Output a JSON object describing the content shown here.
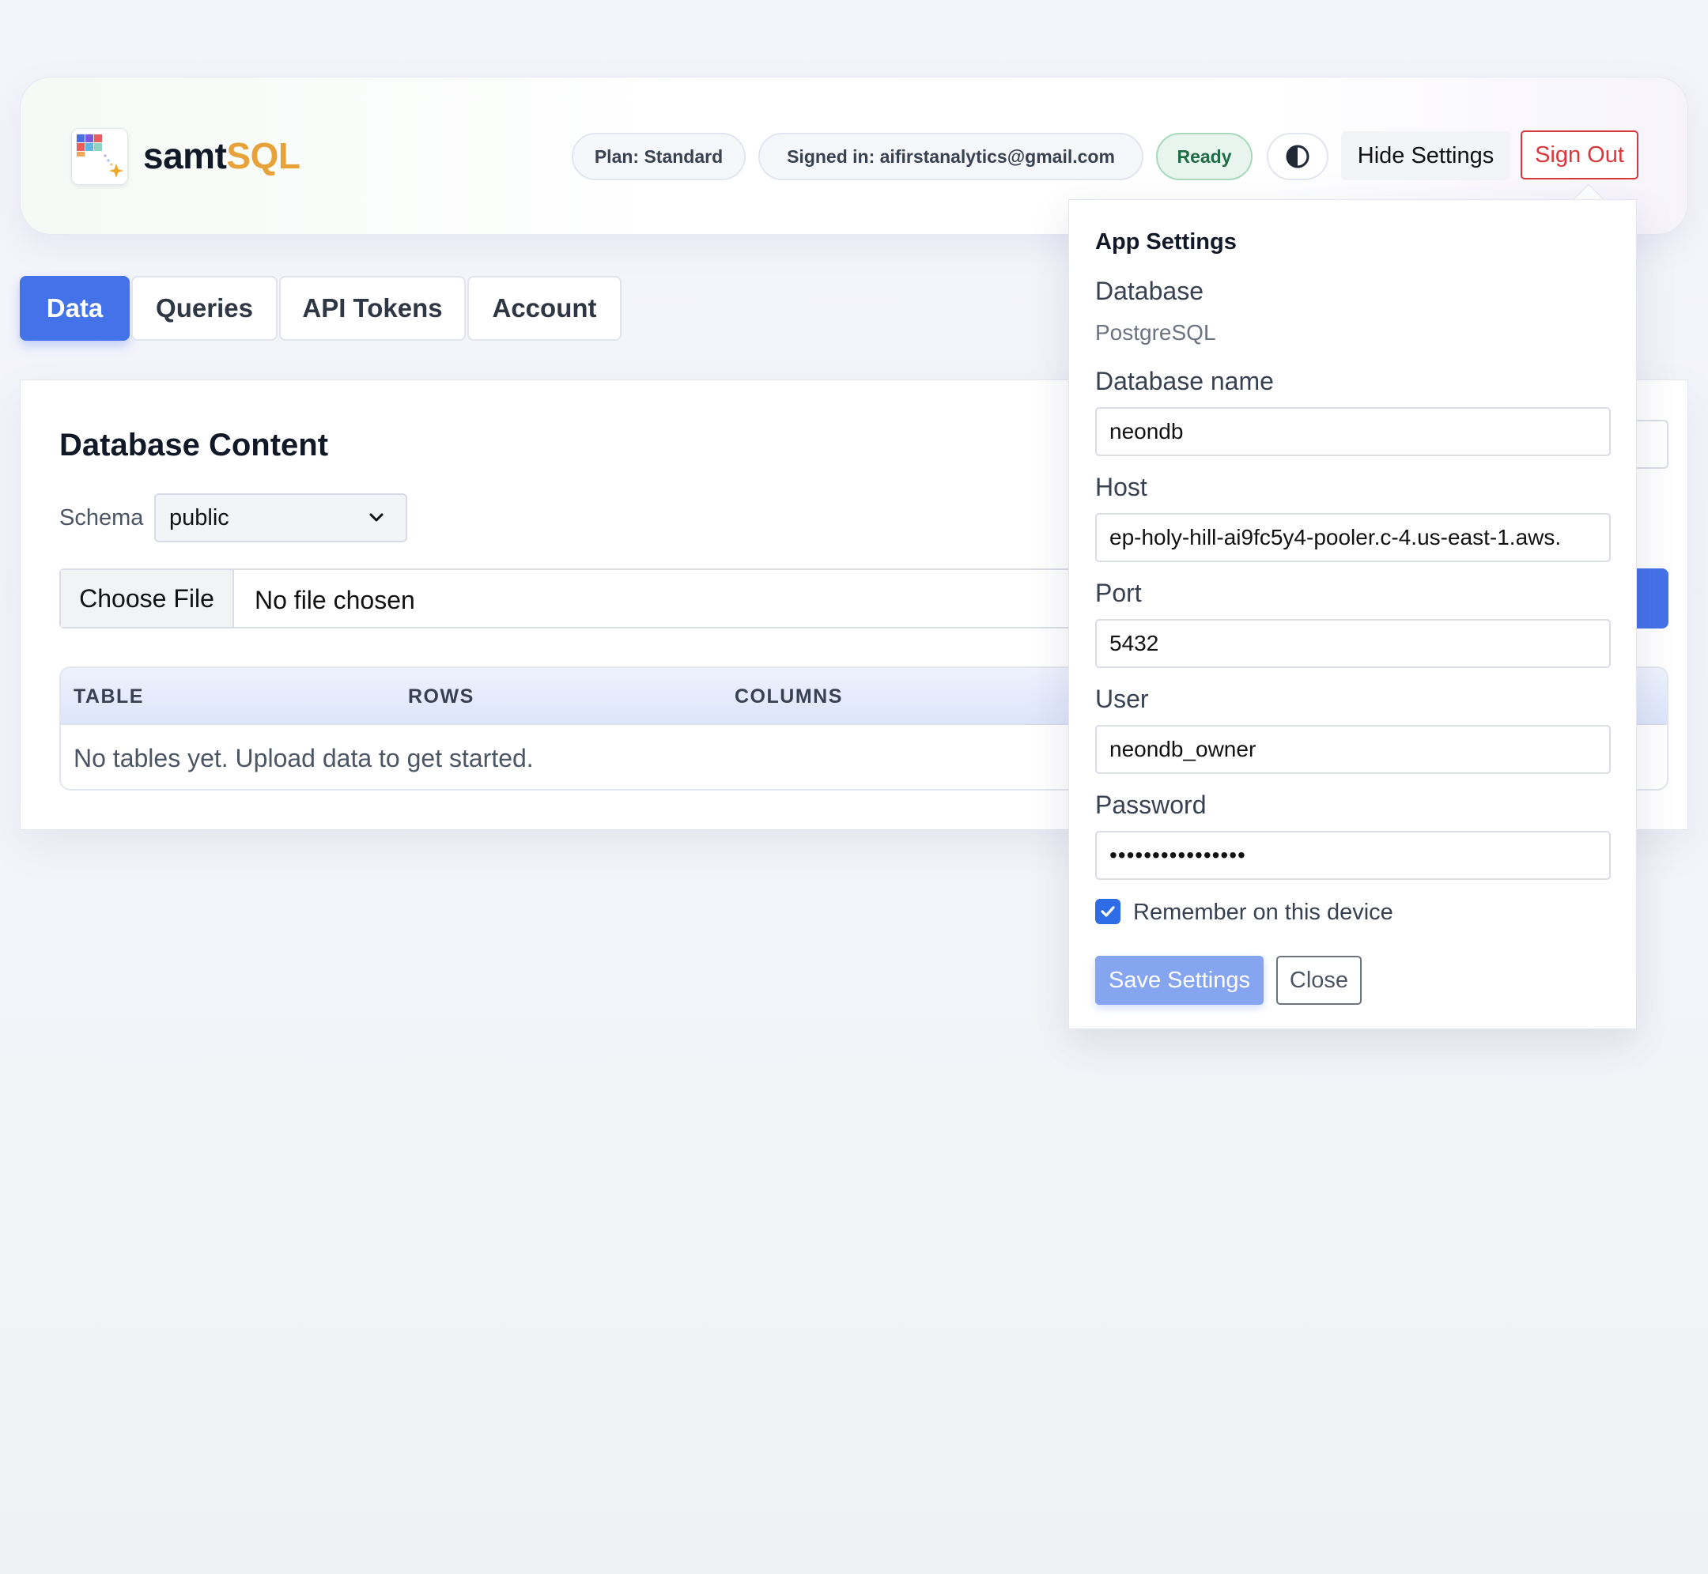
{
  "header": {
    "brand_part1": "samt",
    "brand_part2": "SQL",
    "plan": "Plan: Standard",
    "signed_in": "Signed in: aifirstanalytics@gmail.com",
    "status": "Ready",
    "hide_settings": "Hide Settings",
    "sign_out": "Sign Out",
    "icons": {
      "logo": "sql-grid-sparkle-logo",
      "theme": "contrast-icon"
    }
  },
  "tabs": [
    {
      "label": "Data",
      "active": true
    },
    {
      "label": "Queries",
      "active": false
    },
    {
      "label": "API Tokens",
      "active": false
    },
    {
      "label": "Account",
      "active": false
    }
  ],
  "main": {
    "title": "Database Content",
    "schema_label": "Schema",
    "schema_value": "public",
    "choose_file": "Choose File",
    "no_file": "No file chosen",
    "table": {
      "columns": [
        "TABLE",
        "ROWS",
        "COLUMNS"
      ],
      "empty_message": "No tables yet. Upload data to get started."
    }
  },
  "settings": {
    "title": "App Settings",
    "database_label": "Database",
    "database_value": "PostgreSQL",
    "db_name_label": "Database name",
    "db_name_value": "neondb",
    "host_label": "Host",
    "host_value": "ep-holy-hill-ai9fc5y4-pooler.c-4.us-east-1.aws.",
    "port_label": "Port",
    "port_value": "5432",
    "user_label": "User",
    "user_value": "neondb_owner",
    "password_label": "Password",
    "password_value": "••••••••••••••••",
    "remember_label": "Remember on this device",
    "remember_checked": true,
    "save_label": "Save Settings",
    "close_label": "Close"
  },
  "colors": {
    "accent": "#4472e8",
    "brand_orange": "#e8a23a",
    "danger": "#d9383a",
    "ready_green": "#1f6b45"
  }
}
